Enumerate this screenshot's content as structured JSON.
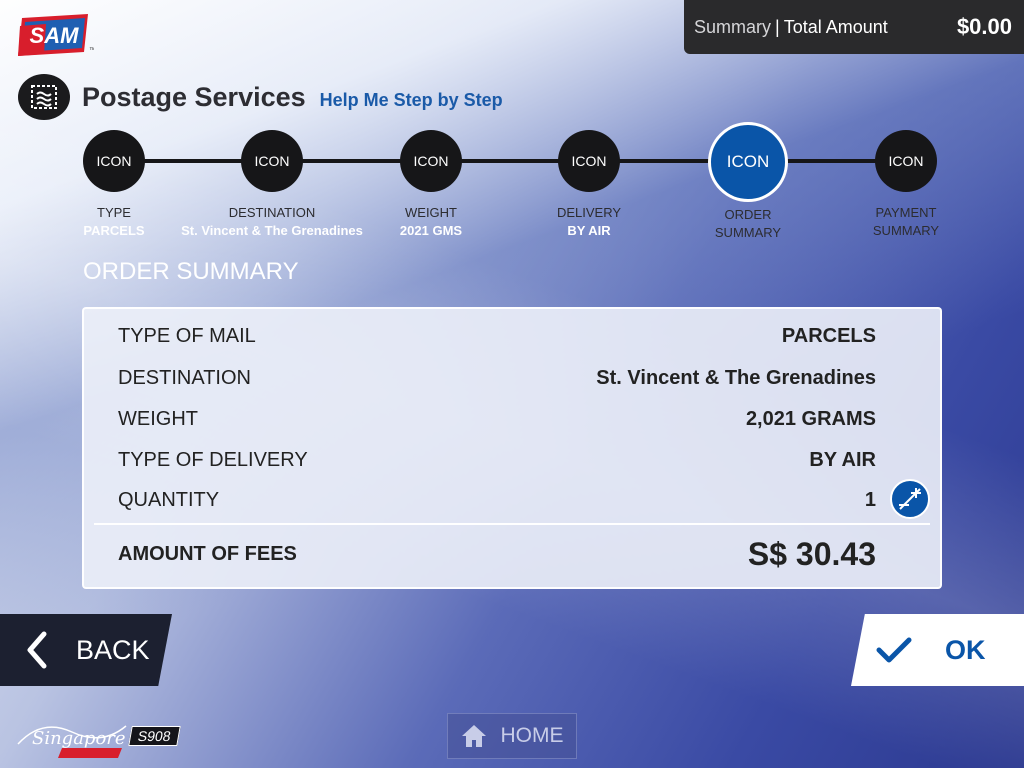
{
  "brand": {
    "logo_text": "SAM",
    "trademark": "™"
  },
  "summary_bar": {
    "summary_label": "Summary",
    "separator": "|",
    "total_label": "Total Amount",
    "amount": "$0.00"
  },
  "header": {
    "title": "Postage Services",
    "help_link": "Help Me Step by Step"
  },
  "stepper": {
    "steps": [
      {
        "icon": "ICON",
        "caption": "TYPE",
        "value": "PARCELS",
        "state": "done"
      },
      {
        "icon": "ICON",
        "caption": "DESTINATION",
        "value": "St. Vincent & The Grenadines",
        "state": "done"
      },
      {
        "icon": "ICON",
        "caption": "WEIGHT",
        "value": "2021 GMS",
        "state": "done"
      },
      {
        "icon": "ICON",
        "caption": "DELIVERY",
        "value": "BY AIR",
        "state": "done"
      },
      {
        "icon": "ICON",
        "caption": "ORDER",
        "value": "SUMMARY",
        "state": "active"
      },
      {
        "icon": "ICON",
        "caption": "PAYMENT",
        "value": "SUMMARY",
        "state": "pending"
      }
    ]
  },
  "order_summary": {
    "title": "ORDER SUMMARY",
    "rows": [
      {
        "label": "TYPE OF MAIL",
        "value": "PARCELS"
      },
      {
        "label": "DESTINATION",
        "value": "St. Vincent & The Grenadines"
      },
      {
        "label": "WEIGHT",
        "value": "2,021 GRAMS"
      },
      {
        "label": "TYPE OF DELIVERY",
        "value": "BY AIR"
      },
      {
        "label": "QUANTITY",
        "value": "1"
      }
    ],
    "fees_label": "AMOUNT OF FEES",
    "fees_value": "S$ 30.43"
  },
  "actions": {
    "back_label": "BACK",
    "ok_label": "OK"
  },
  "footer": {
    "logo_text": "Singapore POST",
    "kiosk_id": "S908",
    "home_label": "HOME"
  },
  "colors": {
    "accent": "#0a55a8",
    "dark": "#161618",
    "summary_bar": "#2a2a2c"
  },
  "icons": [
    "stamp-icon",
    "chevron-left-icon",
    "checkmark-icon",
    "plus-minus-icon",
    "home-icon"
  ]
}
